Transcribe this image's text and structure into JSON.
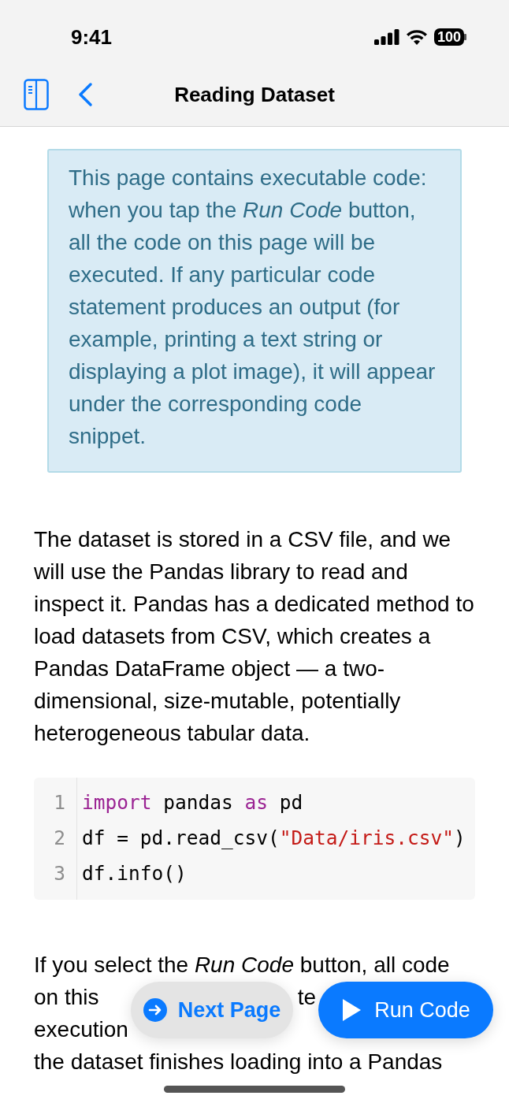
{
  "status_bar": {
    "time": "9:41",
    "battery": "100"
  },
  "nav_bar": {
    "title": "Reading Dataset"
  },
  "info_box": {
    "text": "This page contains executable code: when you tap the *Run Code* button, all the code on this page will be executed. If any particular code statement produces an output (for example, printing a text string or displaying a plot image), it will appear under the corresponding code snippet."
  },
  "paragraph": "The dataset is stored in a CSV file, and we will use the Pandas library to read and inspect it. Pandas has a dedicated method to load datasets from CSV, which creates a Pandas DataFrame object — a two-dimensional, size-mutable, potentially heterogeneous tabular data.",
  "code_block": {
    "lines": [
      {
        "number": "1",
        "tokens": [
          {
            "kind": "keyword",
            "text": "import"
          },
          {
            "kind": "plain",
            "text": " pandas "
          },
          {
            "kind": "keyword",
            "text": "as"
          },
          {
            "kind": "plain",
            "text": " pd"
          }
        ]
      },
      {
        "number": "2",
        "tokens": [
          {
            "kind": "plain",
            "text": "df = pd.read_csv("
          },
          {
            "kind": "string",
            "text": "\"Data/iris.csv\""
          },
          {
            "kind": "plain",
            "text": ")"
          }
        ]
      },
      {
        "number": "3",
        "tokens": [
          {
            "kind": "plain",
            "text": "df.info()"
          }
        ]
      }
    ]
  },
  "covered_paragraph": {
    "lines": [
      {
        "parts": [
          "If you select the *Run Code* button, all code"
        ]
      },
      {
        "parts": [
          "on this",
          "te"
        ]
      },
      {
        "parts": [
          "execution"
        ]
      },
      {
        "parts": [
          "the dataset finishes loading into a Pandas"
        ]
      }
    ]
  },
  "floating_buttons": [
    {
      "kind": "secondary",
      "label": "Next Page"
    },
    {
      "kind": "primary",
      "label": "Run Code"
    }
  ]
}
